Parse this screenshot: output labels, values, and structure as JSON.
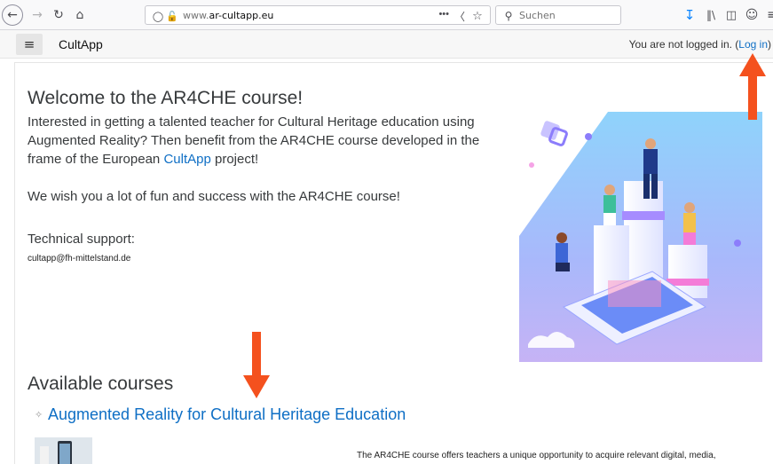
{
  "browser": {
    "url_host": "www.ar-cultapp.eu",
    "url_prefix": "www.",
    "url_domain": "ar-cultapp.eu",
    "url_actions": "•••",
    "search_placeholder": "Suchen"
  },
  "header": {
    "site_name": "CultApp",
    "login_text": "You are not logged in. (",
    "login_link": "Log in",
    "login_close": ")"
  },
  "main": {
    "welcome_title": "Welcome to the AR4CHE course!",
    "intro_before": "Interested in getting a talented teacher for Cultural Heritage education using Augmented Reality? Then benefit from the AR4CHE course developed in the frame of the European ",
    "intro_link": "CultApp",
    "intro_after": " project!",
    "wish": "We wish you a lot of fun and success with the AR4CHE course!",
    "support_heading": "Technical support:",
    "support_email": "cultapp@fh-mittelstand.de",
    "available_heading": "Available courses",
    "course_title": "Augmented Reality for Cultural Heritage Education",
    "course_summary": "The AR4CHE course offers teachers a unique opportunity to acquire relevant digital, media,"
  },
  "colors": {
    "link": "#0f6fc5",
    "annotation_arrow": "#f4511e"
  }
}
